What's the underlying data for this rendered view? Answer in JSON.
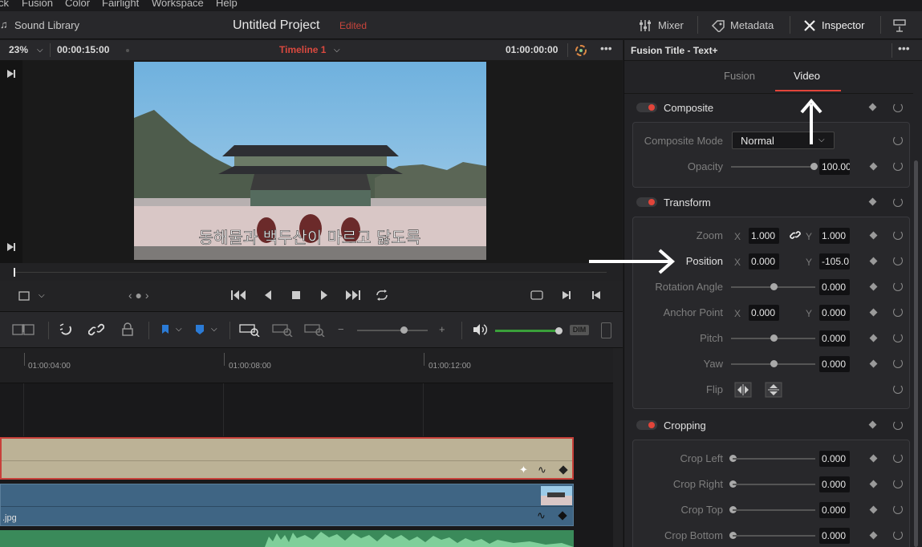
{
  "menu": [
    "ck",
    "Fusion",
    "Color",
    "Fairlight",
    "Workspace",
    "Help"
  ],
  "topbar": {
    "sound_library": "Sound Library",
    "project_title": "Untitled Project",
    "edited": "Edited",
    "mixer": "Mixer",
    "metadata": "Metadata",
    "inspector": "Inspector"
  },
  "viewer": {
    "zoom": "23%",
    "duration": "00:00:15:00",
    "timeline_name": "Timeline 1",
    "timecode": "01:00:00:00",
    "subtitle": "동해물과 백두산이 마르고 닳도록"
  },
  "timeline": {
    "ruler": [
      "01:00:04:00",
      "01:00:08:00",
      "01:00:12:00"
    ],
    "clip_label": ".jpg",
    "dim": "DIM"
  },
  "inspector": {
    "title": "Fusion Title - Text+",
    "tabs": [
      "Fusion",
      "Video"
    ],
    "active_tab": "Video",
    "composite": {
      "title": "Composite",
      "mode_label": "Composite Mode",
      "mode_value": "Normal",
      "opacity_label": "Opacity",
      "opacity_value": "100.00"
    },
    "transform": {
      "title": "Transform",
      "zoom_label": "Zoom",
      "zoom_x": "1.000",
      "zoom_y": "1.000",
      "position_label": "Position",
      "position_x": "0.000",
      "position_y": "-105.0",
      "rotation_label": "Rotation Angle",
      "rotation_value": "0.000",
      "anchor_label": "Anchor Point",
      "anchor_x": "0.000",
      "anchor_y": "0.000",
      "pitch_label": "Pitch",
      "pitch_value": "0.000",
      "yaw_label": "Yaw",
      "yaw_value": "0.000",
      "flip_label": "Flip"
    },
    "cropping": {
      "title": "Cropping",
      "left_label": "Crop Left",
      "left_value": "0.000",
      "right_label": "Crop Right",
      "right_value": "0.000",
      "top_label": "Crop Top",
      "top_value": "0.000",
      "bottom_label": "Crop Bottom",
      "bottom_value": "0.000"
    },
    "x": "X",
    "y": "Y"
  },
  "colors": {
    "accent_red": "#e2453a",
    "title_clip": "#bcb296",
    "video_clip": "#3f6584",
    "audio_clip": "#3a8a5a"
  }
}
